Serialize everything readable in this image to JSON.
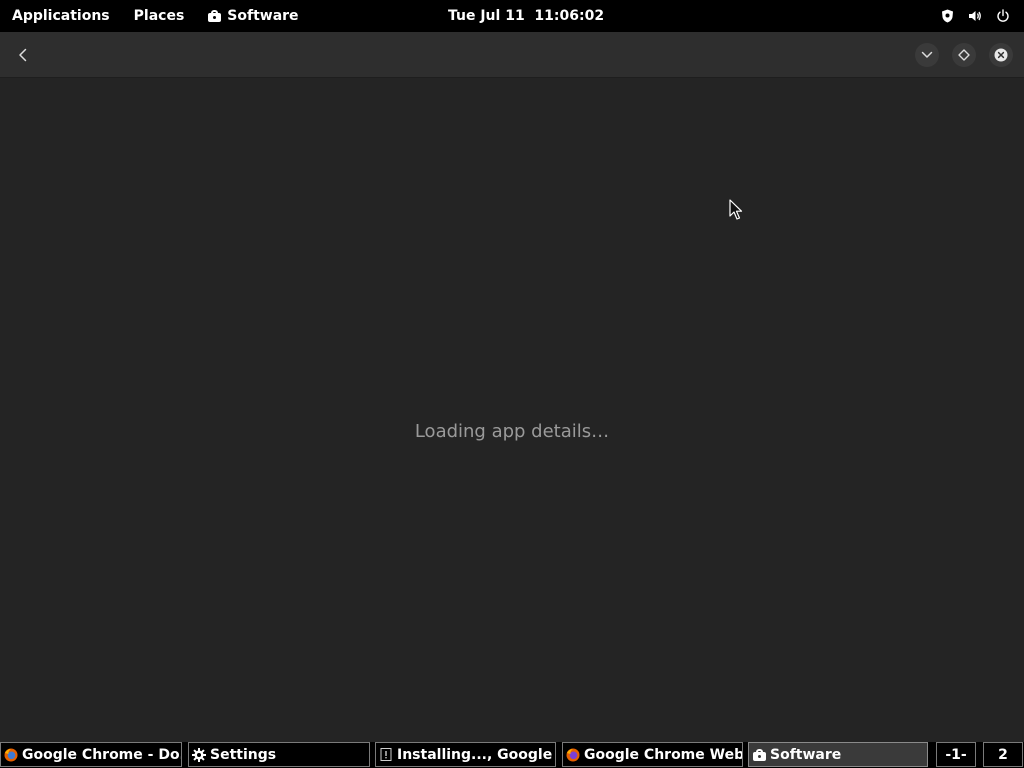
{
  "topbar": {
    "applications": "Applications",
    "places": "Places",
    "active_app": "Software",
    "clock": "Tue Jul 11  11:06:02"
  },
  "main": {
    "loading_text": "Loading app details…"
  },
  "taskbar": {
    "tasks": [
      {
        "label": "Google Chrome - Do...",
        "icon": "firefox-icon"
      },
      {
        "label": "Settings",
        "icon": "gear-icon"
      },
      {
        "label": "Installing..., Google ...",
        "icon": "warning-icon"
      },
      {
        "label": "Google Chrome Web...",
        "icon": "firefox-icon"
      },
      {
        "label": "Software",
        "icon": "software-bag-icon"
      }
    ],
    "workspaces": [
      "-1-",
      "2"
    ]
  },
  "colors": {
    "topbar_bg": "#000000",
    "headerbar_bg": "#2e2e2e",
    "content_bg": "#242424",
    "loading_text": "#9a9a9a"
  }
}
